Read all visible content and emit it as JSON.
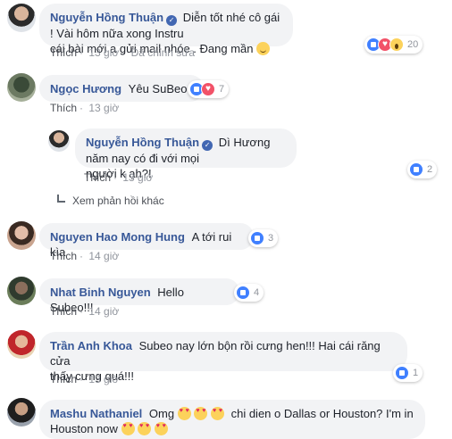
{
  "comments": [
    {
      "author": "Nguyễn Hồng Thuận",
      "text_line1": "Diễn tốt nhé cô gái ! Vài hôm nữa xong Instru",
      "text_line2": "cái bài mới a gửi mail nhóe . Đang mần",
      "reactions": [
        "like",
        "love",
        "wow"
      ],
      "reaction_count": "20",
      "like_label": "Thích",
      "time": "13 giờ",
      "edited": "Đã chỉnh sửa"
    },
    {
      "author": "Ngọc Hương",
      "text": "Yêu SuBeo",
      "reactions": [
        "like",
        "love"
      ],
      "reaction_count": "7",
      "like_label": "Thích",
      "time": "13 giờ"
    },
    {
      "author": "Nguyễn Hồng Thuận",
      "text_line1": "Dì Hương năm nay có đi với mọi",
      "text_line2": "người k ạh?!",
      "reactions": [
        "like"
      ],
      "reaction_count": "2",
      "like_label": "Thích",
      "time": "13 giờ"
    },
    {
      "author": "Nguyen Hao Mong Hung",
      "text": "A tới rui kìa",
      "reactions": [
        "like"
      ],
      "reaction_count": "3",
      "like_label": "Thích",
      "time": "14 giờ"
    },
    {
      "author": "Nhat Binh Nguyen",
      "text": "Hello Subeo!!!",
      "reactions": [
        "like"
      ],
      "reaction_count": "4",
      "like_label": "Thích",
      "time": "14 giờ"
    },
    {
      "author": "Trần Anh Khoa",
      "text_line1": "Subeo nay lớn bộn rồi cưng hen!!! Hai cái răng cửa",
      "text_line2": "thấy cưng quá!!!",
      "reactions": [
        "like"
      ],
      "reaction_count": "1",
      "like_label": "Thích",
      "time": "13 giờ"
    },
    {
      "author": "Mashu Nathaniel",
      "text_line1_a": "Omg",
      "text_line1_b": "chi dien o Dallas or Houston? I'm in",
      "text_line2": "Houston now"
    }
  ],
  "more_replies_label": "Xem phản hồi khác",
  "colors": {
    "author": "#385898",
    "bubble_bg": "#f2f3f5",
    "meta": "#90949c",
    "like_blue": "#4080ff",
    "love_red": "#f25268"
  }
}
